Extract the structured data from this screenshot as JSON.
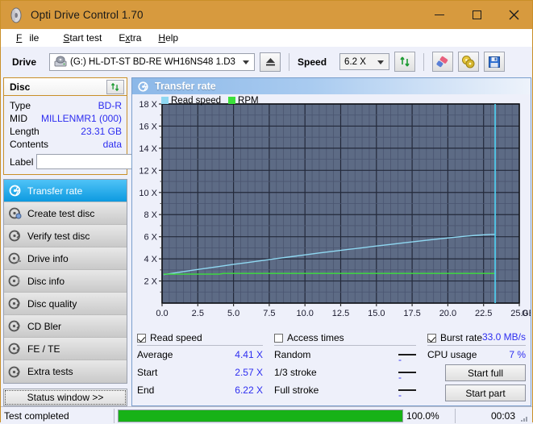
{
  "window": {
    "title": "Opti Drive Control 1.70",
    "app_icon": "disc-icon",
    "minimize": "–",
    "maximize": "□",
    "close": "✕"
  },
  "menu": {
    "items": [
      {
        "label": "File",
        "accel": "F"
      },
      {
        "label": "Start test",
        "accel": "S"
      },
      {
        "label": "Extra",
        "accel": "x"
      },
      {
        "label": "Help",
        "accel": "H"
      }
    ]
  },
  "toolbar": {
    "drive_label": "Drive",
    "drive_value": "(G:)  HL-DT-ST BD-RE  WH16NS48 1.D3",
    "eject_title": "Eject",
    "speed_label": "Speed",
    "speed_value": "6.2 X",
    "refresh_title": "Refresh",
    "erase_title": "Erase",
    "discs_title": "Discs",
    "save_title": "Save"
  },
  "disc": {
    "header": "Disc",
    "rows": [
      {
        "key": "Type",
        "value": "BD-R"
      },
      {
        "key": "MID",
        "value": "MILLENMR1 (000)"
      },
      {
        "key": "Length",
        "value": "23.31 GB"
      },
      {
        "key": "Contents",
        "value": "data"
      }
    ],
    "label_key": "Label",
    "label_value": "",
    "label_placeholder": ""
  },
  "sidebar": {
    "items": [
      {
        "label": "Transfer rate",
        "active": true
      },
      {
        "label": "Create test disc",
        "active": false
      },
      {
        "label": "Verify test disc",
        "active": false
      },
      {
        "label": "Drive info",
        "active": false
      },
      {
        "label": "Disc info",
        "active": false
      },
      {
        "label": "Disc quality",
        "active": false
      },
      {
        "label": "CD Bler",
        "active": false
      },
      {
        "label": "FE / TE",
        "active": false
      },
      {
        "label": "Extra tests",
        "active": false
      }
    ],
    "status_window": "Status window >>"
  },
  "panel": {
    "title": "Transfer rate"
  },
  "chart_data": {
    "type": "line",
    "title": "Transfer rate",
    "xlabel": "GB",
    "ylabel": "X",
    "xlim": [
      0.0,
      25.0
    ],
    "ylim": [
      0,
      18
    ],
    "xticks": [
      "0.0",
      "2.5",
      "5.0",
      "7.5",
      "10.0",
      "12.5",
      "15.0",
      "17.5",
      "20.0",
      "22.5",
      "25.0"
    ],
    "xtick_values": [
      0.0,
      2.5,
      5.0,
      7.5,
      10.0,
      12.5,
      15.0,
      17.5,
      20.0,
      22.5,
      25.0
    ],
    "yticks": [
      "2 X",
      "4 X",
      "6 X",
      "8 X",
      "10 X",
      "12 X",
      "14 X",
      "16 X",
      "18 X"
    ],
    "ytick_values": [
      2,
      4,
      6,
      8,
      10,
      12,
      14,
      16,
      18
    ],
    "grid": true,
    "legend_position": "top-left",
    "plot_bg": "#5d6b85",
    "grid_color": "#3c4659",
    "cursor_x": 23.31,
    "cursor_color": "#4fd4f5",
    "legend": [
      {
        "name": "Read speed",
        "color": "#8fd8f2"
      },
      {
        "name": "RPM",
        "color": "#3ce03c"
      }
    ],
    "series": [
      {
        "name": "Read speed",
        "color": "#8fd8f2",
        "x": [
          0.1,
          1.0,
          2.0,
          3.0,
          4.0,
          5.0,
          6.0,
          7.0,
          8.0,
          9.0,
          10.0,
          11.0,
          12.0,
          13.0,
          14.0,
          15.0,
          16.0,
          17.0,
          18.0,
          19.0,
          20.0,
          21.0,
          22.0,
          23.0,
          23.31
        ],
        "values": [
          2.57,
          2.75,
          2.95,
          3.13,
          3.31,
          3.5,
          3.67,
          3.85,
          4.02,
          4.19,
          4.36,
          4.53,
          4.69,
          4.85,
          5.0,
          5.16,
          5.31,
          5.46,
          5.61,
          5.75,
          5.89,
          6.02,
          6.13,
          6.21,
          6.22
        ]
      },
      {
        "name": "RPM",
        "color": "#3ce03c",
        "x": [
          0.1,
          4.0,
          4.3,
          23.31
        ],
        "values": [
          2.62,
          2.62,
          2.68,
          2.68
        ]
      }
    ]
  },
  "stats": {
    "read_speed": {
      "checkbox_label": "Read speed",
      "checked": true,
      "rows": [
        {
          "key": "Average",
          "value": "4.41 X"
        },
        {
          "key": "Start",
          "value": "2.57 X"
        },
        {
          "key": "End",
          "value": "6.22 X"
        }
      ]
    },
    "access_times": {
      "checkbox_label": "Access times",
      "checked": false,
      "rows": [
        {
          "key": "Random",
          "value": "-"
        },
        {
          "key": "1/3 stroke",
          "value": "-"
        },
        {
          "key": "Full stroke",
          "value": "-"
        }
      ]
    },
    "burst": {
      "checkbox_label": "Burst rate",
      "checked": true,
      "value": "33.0 MB/s",
      "cpu_key": "CPU usage",
      "cpu_value": "7 %"
    },
    "buttons": [
      {
        "label": "Start full"
      },
      {
        "label": "Start part"
      }
    ]
  },
  "statusbar": {
    "message": "Test completed",
    "percent_label": "100.0%",
    "percent_value": 100,
    "time": "00:03",
    "bar_color": "#17b217"
  }
}
